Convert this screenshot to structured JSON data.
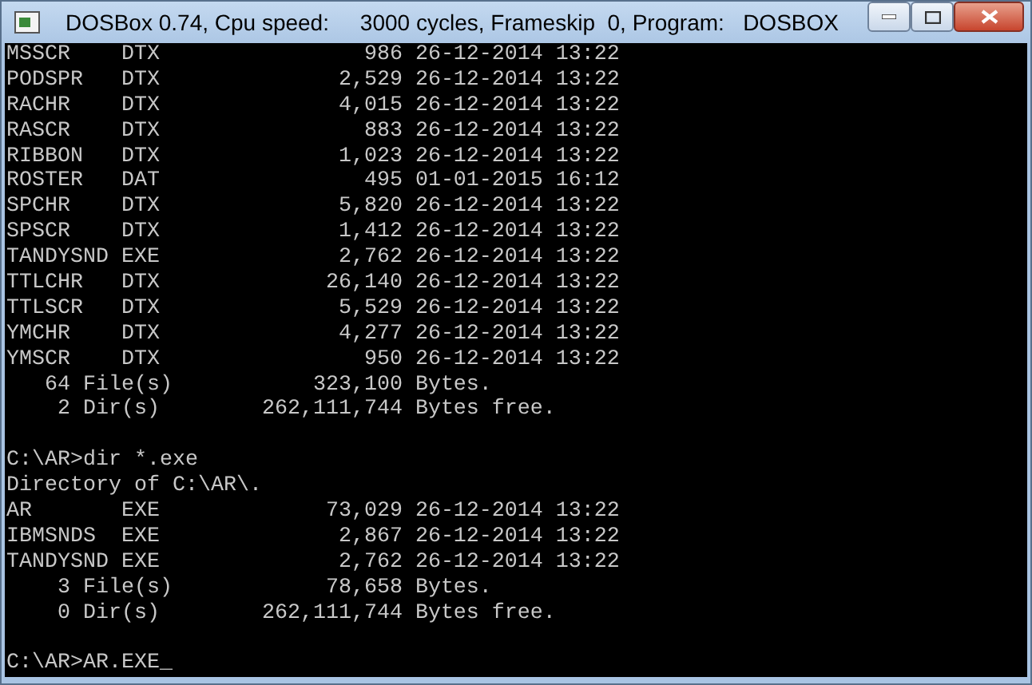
{
  "window": {
    "title": "DOSBox 0.74, Cpu speed:     3000 cycles, Frameskip  0, Program:   DOSBOX"
  },
  "console_lines": [
    {
      "kind": "text",
      "text": "MSSCR    DTX                986 26-12-2014 13:22"
    },
    {
      "kind": "text",
      "text": "PODSPR   DTX              2,529 26-12-2014 13:22"
    },
    {
      "kind": "text",
      "text": "RACHR    DTX              4,015 26-12-2014 13:22"
    },
    {
      "kind": "text",
      "text": "RASCR    DTX                883 26-12-2014 13:22"
    },
    {
      "kind": "text",
      "text": "RIBBON   DTX              1,023 26-12-2014 13:22"
    },
    {
      "kind": "text",
      "text": "ROSTER   DAT                495 01-01-2015 16:12"
    },
    {
      "kind": "text",
      "text": "SPCHR    DTX              5,820 26-12-2014 13:22"
    },
    {
      "kind": "text",
      "text": "SPSCR    DTX              1,412 26-12-2014 13:22"
    },
    {
      "kind": "text",
      "text": "TANDYSND EXE              2,762 26-12-2014 13:22"
    },
    {
      "kind": "text",
      "text": "TTLCHR   DTX             26,140 26-12-2014 13:22"
    },
    {
      "kind": "text",
      "text": "TTLSCR   DTX              5,529 26-12-2014 13:22"
    },
    {
      "kind": "text",
      "text": "YMCHR    DTX              4,277 26-12-2014 13:22"
    },
    {
      "kind": "text",
      "text": "YMSCR    DTX                950 26-12-2014 13:22"
    },
    {
      "kind": "text",
      "text": "   64 File(s)           323,100 Bytes."
    },
    {
      "kind": "text",
      "text": "    2 Dir(s)        262,111,744 Bytes free."
    },
    {
      "kind": "blank"
    },
    {
      "kind": "text",
      "text": "C:\\AR>dir *.exe"
    },
    {
      "kind": "text",
      "text": "Directory of C:\\AR\\."
    },
    {
      "kind": "text",
      "text": "AR       EXE             73,029 26-12-2014 13:22"
    },
    {
      "kind": "text",
      "text": "IBMSNDS  EXE              2,867 26-12-2014 13:22"
    },
    {
      "kind": "text",
      "text": "TANDYSND EXE              2,762 26-12-2014 13:22"
    },
    {
      "kind": "text",
      "text": "    3 File(s)            78,658 Bytes."
    },
    {
      "kind": "text",
      "text": "    0 Dir(s)        262,111,744 Bytes free."
    },
    {
      "kind": "blank"
    },
    {
      "kind": "text",
      "text": "C:\\AR>AR.EXE_"
    }
  ]
}
